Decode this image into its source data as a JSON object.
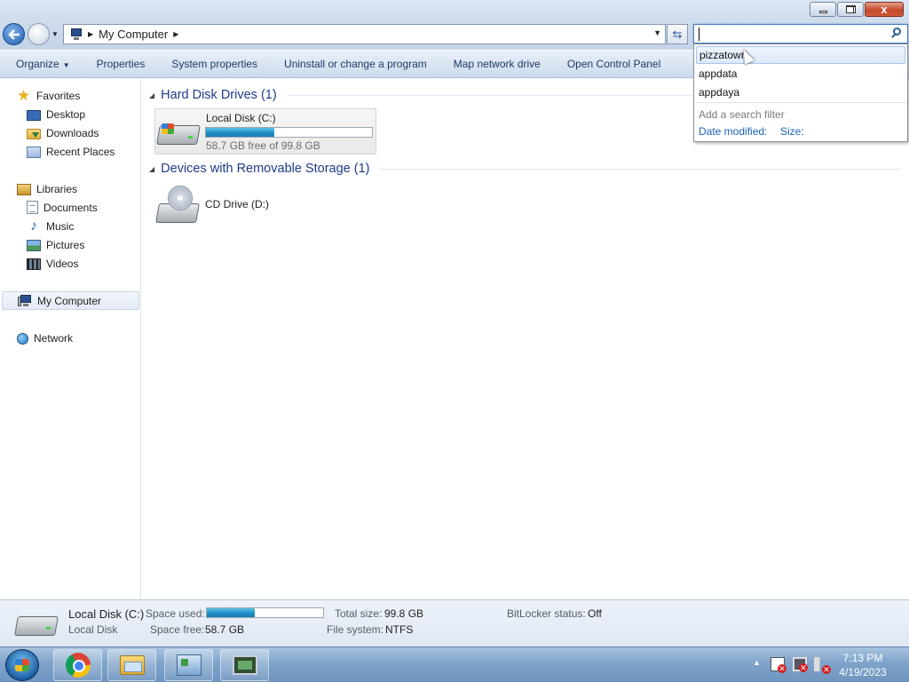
{
  "window": {
    "minimize_glyph": "",
    "close_glyph": "x"
  },
  "address": {
    "location": "My Computer",
    "icon": "computer-icon"
  },
  "search": {
    "value": "",
    "placeholder": "",
    "suggestions": [
      "pizzatown",
      "appdata",
      "appdaya"
    ],
    "hovered_index": 0,
    "filter_hint": "Add a search filter",
    "filters": [
      "Date modified:",
      "Size:"
    ]
  },
  "toolbar": {
    "organize": "Organize",
    "properties": "Properties",
    "system_properties": "System properties",
    "uninstall": "Uninstall or change a program",
    "map_drive": "Map network drive",
    "control_panel": "Open Control Panel"
  },
  "nav": {
    "favorites": "Favorites",
    "desktop": "Desktop",
    "downloads": "Downloads",
    "recent": "Recent Places",
    "libraries": "Libraries",
    "documents": "Documents",
    "music": "Music",
    "pictures": "Pictures",
    "videos": "Videos",
    "computer": "My Computer",
    "network": "Network"
  },
  "content": {
    "hdd_group": "Hard Disk Drives (1)",
    "removable_group": "Devices with Removable Storage (1)",
    "local_disk": {
      "name": "Local Disk (C:)",
      "free_text": "58.7 GB free of 99.8 GB",
      "used_fraction": 0.412
    },
    "cd_drive": {
      "name": "CD Drive (D:)"
    }
  },
  "details": {
    "title": "Local Disk (C:)",
    "subtitle": "Local Disk",
    "space_used_label": "Space used:",
    "space_free_label": "Space free:",
    "space_free": "58.7 GB",
    "total_size_label": "Total size:",
    "total_size": "99.8 GB",
    "file_system_label": "File system:",
    "file_system": "NTFS",
    "bitlocker_label": "BitLocker status:",
    "bitlocker": "Off"
  },
  "taskbar": {
    "apps": [
      "chrome-icon",
      "explorer-icon",
      "control-panel-icon",
      "image-viewer-icon"
    ],
    "time": "7:13 PM",
    "date": "4/19/2023"
  }
}
